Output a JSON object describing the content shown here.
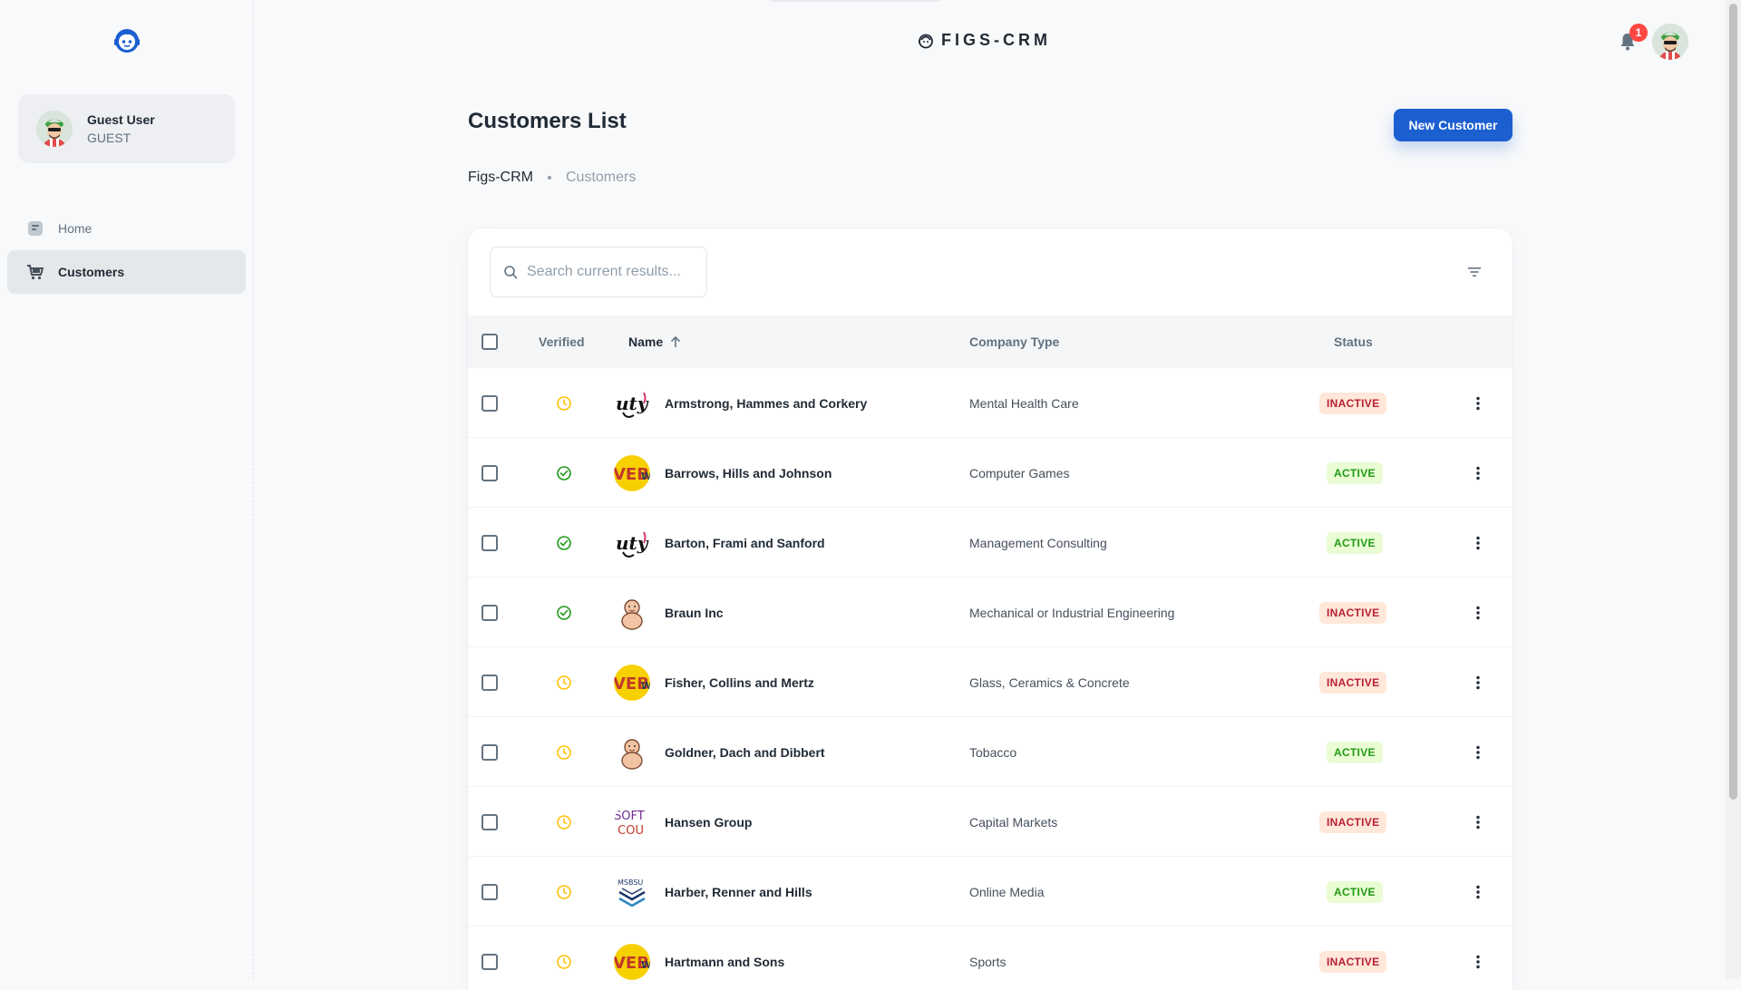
{
  "app": {
    "brand": "FIGS-CRM",
    "accent": "#1b5fd1"
  },
  "sidebar": {
    "user": {
      "name": "Guest User",
      "role": "GUEST"
    },
    "items": [
      {
        "label": "Home",
        "icon": "dashboard-icon",
        "active": false
      },
      {
        "label": "Customers",
        "icon": "cart-icon",
        "active": true
      }
    ]
  },
  "header": {
    "notifications_count": "1"
  },
  "main": {
    "title": "Customers List",
    "new_button": "New Customer",
    "breadcrumb": {
      "root": "Figs-CRM",
      "current": "Customers"
    },
    "search": {
      "placeholder": "Search current results..."
    },
    "columns": {
      "verified": "Verified",
      "name": "Name",
      "company_type": "Company Type",
      "status": "Status"
    },
    "customers": [
      {
        "verified": "pending",
        "logo": "script",
        "name": "Armstrong, Hammes and Corkery",
        "company_type": "Mental Health Care",
        "status": "INACTIVE"
      },
      {
        "verified": "verified",
        "logo": "web",
        "name": "Barrows, Hills and Johnson",
        "company_type": "Computer Games",
        "status": "ACTIVE"
      },
      {
        "verified": "verified",
        "logo": "script",
        "name": "Barton, Frami and Sanford",
        "company_type": "Management Consulting",
        "status": "ACTIVE"
      },
      {
        "verified": "verified",
        "logo": "baby",
        "name": "Braun Inc",
        "company_type": "Mechanical or Industrial Engineering",
        "status": "INACTIVE"
      },
      {
        "verified": "pending",
        "logo": "web",
        "name": "Fisher, Collins and Mertz",
        "company_type": "Glass, Ceramics & Concrete",
        "status": "INACTIVE"
      },
      {
        "verified": "pending",
        "logo": "baby",
        "name": "Goldner, Dach and Dibbert",
        "company_type": "Tobacco",
        "status": "ACTIVE"
      },
      {
        "verified": "pending",
        "logo": "soft",
        "name": "Hansen Group",
        "company_type": "Capital Markets",
        "status": "INACTIVE"
      },
      {
        "verified": "pending",
        "logo": "wave",
        "name": "Harber, Renner and Hills",
        "company_type": "Online Media",
        "status": "ACTIVE"
      },
      {
        "verified": "pending",
        "logo": "web",
        "name": "Hartmann and Sons",
        "company_type": "Sports",
        "status": "INACTIVE"
      }
    ]
  }
}
